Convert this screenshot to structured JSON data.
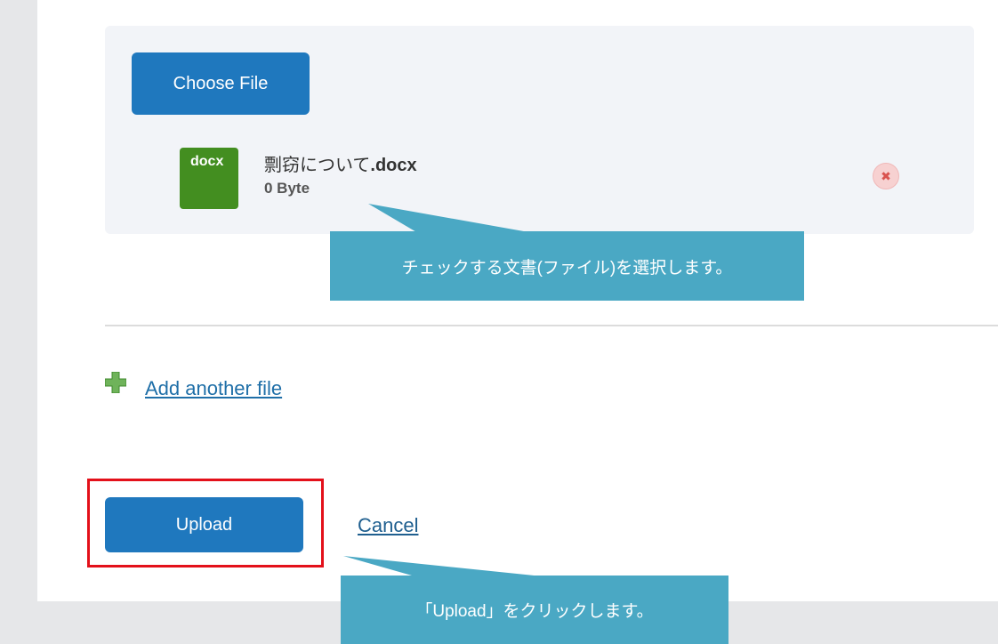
{
  "upload_form": {
    "choose_file_label": "Choose File",
    "file": {
      "type_badge": "docx",
      "name_base": "剽窃について",
      "name_ext": ".docx",
      "size": "0 Byte"
    },
    "add_another_label": "Add another file",
    "upload_label": "Upload",
    "cancel_label": "Cancel"
  },
  "annotations": {
    "select_document": "チェックする文書(ファイル)を選択します。",
    "click_upload": "「Upload」をクリックします。"
  },
  "icons": {
    "remove": "close-circle-icon",
    "add": "plus-icon"
  },
  "colors": {
    "primary_button": "#1f78be",
    "file_badge": "#438e20",
    "callout": "#4aa8c4",
    "highlight_border": "#e3101a"
  }
}
